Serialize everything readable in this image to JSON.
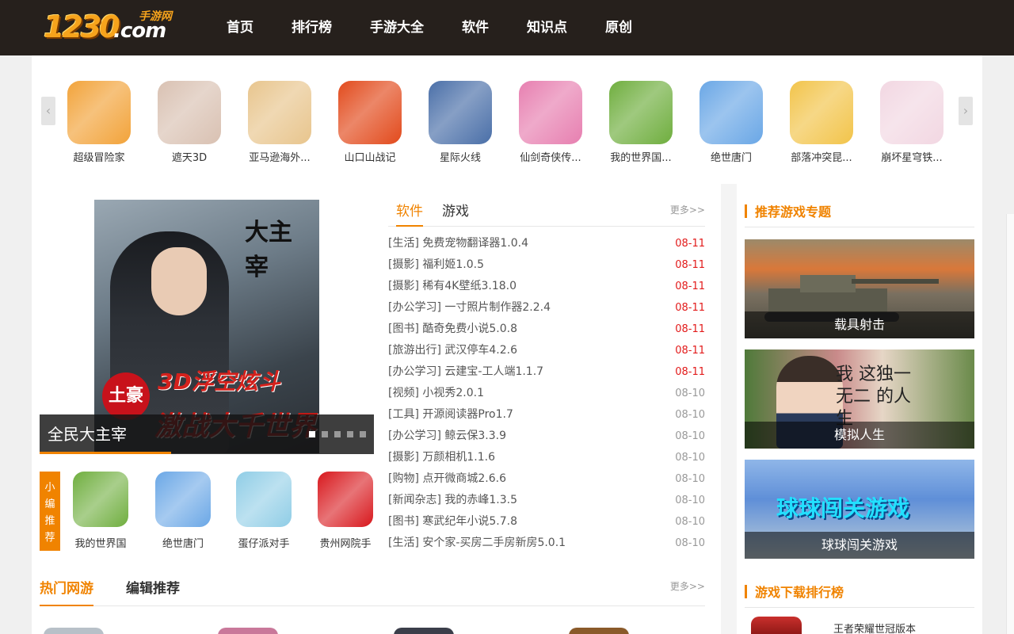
{
  "header": {
    "logo_number": "1230",
    "logo_domain": ".com",
    "logo_tagline": "手游网",
    "nav": [
      "首页",
      "排行榜",
      "手游大全",
      "软件",
      "知识点",
      "原创"
    ]
  },
  "carousel": {
    "prev_glyph": "‹",
    "next_glyph": "›",
    "apps": [
      {
        "name": "超级冒险家",
        "icon": "mushroom-game-icon",
        "color": "#f2a33a"
      },
      {
        "name": "遮天3D",
        "icon": "portrait-game-icon",
        "color": "#d9c1b2"
      },
      {
        "name": "亚马逊海外...",
        "icon": "amazon-icon",
        "color": "#e8c58d"
      },
      {
        "name": "山口山战记",
        "icon": "angry-face-game-icon",
        "color": "#e24a1c"
      },
      {
        "name": "星际火线",
        "icon": "soldier-game-icon",
        "color": "#4a6fa8"
      },
      {
        "name": "仙剑奇侠传...",
        "icon": "anime-girl-game-icon",
        "color": "#e77fb0"
      },
      {
        "name": "我的世界国...",
        "icon": "minecraft-icon",
        "color": "#6fae3e"
      },
      {
        "name": "绝世唐门",
        "icon": "tangmen-game-icon",
        "color": "#6aa7e6"
      },
      {
        "name": "部落冲突昆...",
        "icon": "clash-game-icon",
        "color": "#f2c44a"
      },
      {
        "name": "崩坏星穹铁...",
        "icon": "star-rail-game-icon",
        "color": "#f2d7e2"
      }
    ]
  },
  "slide": {
    "caption": "全民大主宰",
    "art_calligraphy": "大主宰",
    "art_badge": "土豪",
    "art_line1": "3D浮空炫斗",
    "art_line2": "激战大千世界"
  },
  "picks": {
    "label": [
      "小",
      "编",
      "推",
      "荐"
    ],
    "items": [
      {
        "name": "我的世界国",
        "icon": "minecraft-icon",
        "color": "#6fae3e"
      },
      {
        "name": "绝世唐门",
        "icon": "tangmen-game-icon",
        "color": "#6aa7e6"
      },
      {
        "name": "蛋仔派对手",
        "icon": "eggy-party-icon",
        "color": "#8fcde6"
      },
      {
        "name": "贵州网院手",
        "icon": "guizhou-college-icon",
        "color": "#d8171c"
      }
    ]
  },
  "news": {
    "tabs": [
      "软件",
      "游戏"
    ],
    "more": "更多>>",
    "items": [
      {
        "cat": "[生活]",
        "title": "免费宠物翻译器1.0.4",
        "date": "08-11",
        "red": true
      },
      {
        "cat": "[摄影]",
        "title": "福利姬1.0.5",
        "date": "08-11",
        "red": true
      },
      {
        "cat": "[摄影]",
        "title": "稀有4K壁纸3.18.0",
        "date": "08-11",
        "red": true
      },
      {
        "cat": "[办公学习]",
        "title": "一寸照片制作器2.2.4",
        "date": "08-11",
        "red": true
      },
      {
        "cat": "[图书]",
        "title": "酷奇免费小说5.0.8",
        "date": "08-11",
        "red": true
      },
      {
        "cat": "[旅游出行]",
        "title": "武汉停车4.2.6",
        "date": "08-11",
        "red": true
      },
      {
        "cat": "[办公学习]",
        "title": "云建宝-工人端1.1.7",
        "date": "08-11",
        "red": true
      },
      {
        "cat": "[视频]",
        "title": "小视秀2.0.1",
        "date": "08-10",
        "red": false
      },
      {
        "cat": "[工具]",
        "title": "开源阅读器Pro1.7",
        "date": "08-10",
        "red": false
      },
      {
        "cat": "[办公学习]",
        "title": "鲸云保3.3.9",
        "date": "08-10",
        "red": false
      },
      {
        "cat": "[摄影]",
        "title": "万颜相机1.1.6",
        "date": "08-10",
        "red": false
      },
      {
        "cat": "[购物]",
        "title": "点开微商城2.6.6",
        "date": "08-10",
        "red": false
      },
      {
        "cat": "[新闻杂志]",
        "title": "我的赤峰1.3.5",
        "date": "08-10",
        "red": false
      },
      {
        "cat": "[图书]",
        "title": "寒武纪年小说5.7.8",
        "date": "08-10",
        "red": false
      },
      {
        "cat": "[生活]",
        "title": "安个家-买房二手房新房5.0.1",
        "date": "08-10",
        "red": false
      }
    ]
  },
  "bottom": {
    "tabs": [
      "热门网游",
      "编辑推荐"
    ],
    "more": "更多>>"
  },
  "sidebar": {
    "topics_title": "推荐游戏专题",
    "topics": [
      {
        "name": "载具射击",
        "art_text": "",
        "color": "#6b6558"
      },
      {
        "name": "模拟人生",
        "art_text": "我 这独一无二 的人生",
        "color": "#c2a27d"
      },
      {
        "name": "球球闯关游戏",
        "art_text": "球球闯关游戏",
        "color": "#5f8fd8"
      }
    ],
    "ranking_title": "游戏下载排行榜",
    "ranking_first": "王者荣耀世冠版本"
  }
}
